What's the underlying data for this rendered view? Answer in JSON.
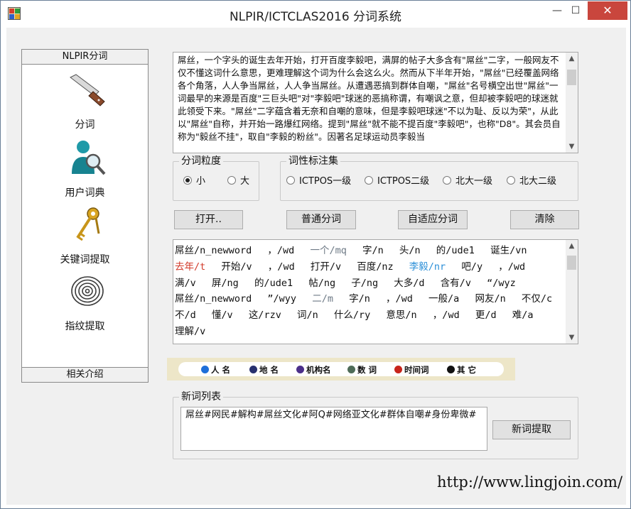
{
  "window": {
    "title": "NLPIR/ICTCLAS2016 分词系统",
    "min_glyph": "—",
    "max_glyph": "☐",
    "close_glyph": "✕"
  },
  "nav": {
    "header": "NLPIR分词",
    "footer": "相关介绍",
    "items": [
      {
        "label": "分词",
        "icon": "knife-icon"
      },
      {
        "label": "用户词典",
        "icon": "user-dictionary-icon"
      },
      {
        "label": "关键词提取",
        "icon": "keys-icon"
      },
      {
        "label": "指纹提取",
        "icon": "fingerprint-icon"
      }
    ]
  },
  "source_text": "  屌丝，一个字头的诞生去年开始，打开百度李毅吧，满屏的帖子大多含有\"屌丝\"二字，一般网友不仅不懂这词什么意思，更难理解这个词为什么会这么火。然而从下半年开始，\"屌丝\"已经覆盖网络各个角落，人人争当屌丝，人人争当屌丝。从遭遇恶搞到群体自嘲，\"屌丝\"名号横空出世\"屌丝\"一词最早的来源是百度\"三巨头吧\"对\"李毅吧\"球迷的恶搞称谓，有嘲讽之意，但却被李毅吧的球迷就此领受下来。\"屌丝\"二字蕴含着无奈和自嘲的意味，但是李毅吧球迷\"不以为耻、反以为荣\"，从此以\"屌丝\"自称，并开始一路爆红网络。提到\"屌丝\"就不能不提百度\"李毅吧\"，也称\"D8\"。其会员自称为\"毅丝不挂\"，取自\"李毅的粉丝\"。因著名足球运动员李毅当",
  "granularity": {
    "legend": "分词粒度",
    "options": [
      "小",
      "大"
    ],
    "selected": 0
  },
  "pos_tagging": {
    "legend": "词性标注集",
    "options": [
      "ICTPOS一级",
      "ICTPOS二级",
      "北大一级",
      "北大二级"
    ],
    "selected": -1
  },
  "buttons": {
    "open": "打开..",
    "normal_seg": "普通分词",
    "adaptive_seg": "自适应分词",
    "clear": "清除",
    "extract_new_words": "新词提取"
  },
  "segmented": [
    {
      "t": "屌丝/n_newword",
      "c": ""
    },
    {
      "t": "，/wd",
      "c": ""
    },
    {
      "t": "一个/mq",
      "c": "mq"
    },
    {
      "t": "字/n",
      "c": ""
    },
    {
      "t": "头/n",
      "c": ""
    },
    {
      "t": "的/ude1",
      "c": ""
    },
    {
      "t": "诞生/vn",
      "c": ""
    },
    {
      "t": "去年/t",
      "c": "ns"
    },
    {
      "t": "开始/v",
      "c": ""
    },
    {
      "t": "，/wd",
      "c": ""
    },
    {
      "t": "打开/v",
      "c": ""
    },
    {
      "t": "百度/nz",
      "c": ""
    },
    {
      "t": "李毅/nr",
      "c": "nr"
    },
    {
      "t": "吧/y",
      "c": ""
    },
    {
      "t": "，/wd",
      "c": ""
    },
    {
      "t": "满/v",
      "c": ""
    },
    {
      "t": "屏/ng",
      "c": ""
    },
    {
      "t": "的/ude1",
      "c": ""
    },
    {
      "t": "帖/ng",
      "c": ""
    },
    {
      "t": "子/ng",
      "c": ""
    },
    {
      "t": "大多/d",
      "c": ""
    },
    {
      "t": "含有/v",
      "c": ""
    },
    {
      "t": "“/wyz",
      "c": ""
    },
    {
      "t": "屌丝/n_newword",
      "c": ""
    },
    {
      "t": "”/wyy",
      "c": ""
    },
    {
      "t": "二/m",
      "c": "mq"
    },
    {
      "t": "字/n",
      "c": ""
    },
    {
      "t": "，/wd",
      "c": ""
    },
    {
      "t": "一般/a",
      "c": ""
    },
    {
      "t": "网友/n",
      "c": ""
    },
    {
      "t": "不仅/c",
      "c": ""
    },
    {
      "t": "不/d",
      "c": ""
    },
    {
      "t": "懂/v",
      "c": ""
    },
    {
      "t": "这/rzv",
      "c": ""
    },
    {
      "t": "词/n",
      "c": ""
    },
    {
      "t": "什么/ry",
      "c": ""
    },
    {
      "t": "意思/n",
      "c": ""
    },
    {
      "t": "，/wd",
      "c": ""
    },
    {
      "t": "更/d",
      "c": ""
    },
    {
      "t": "难/a",
      "c": ""
    },
    {
      "t": "理解/v",
      "c": ""
    }
  ],
  "pos_legend": [
    {
      "label": "人 名",
      "color": "#1e6fd9"
    },
    {
      "label": "地 名",
      "color": "#27306e"
    },
    {
      "label": "机构名",
      "color": "#4b2f8a"
    },
    {
      "label": "数 词",
      "color": "#4e6b57"
    },
    {
      "label": "时间词",
      "color": "#c8241a"
    },
    {
      "label": "其 它",
      "color": "#111111"
    }
  ],
  "new_words": {
    "legend": "新词列表",
    "text": "屌丝#网民#解构#屌丝文化#阿Q#网络亚文化#群体自嘲#身份卑微#"
  },
  "footer_url": "http://www.lingjoin.com/"
}
